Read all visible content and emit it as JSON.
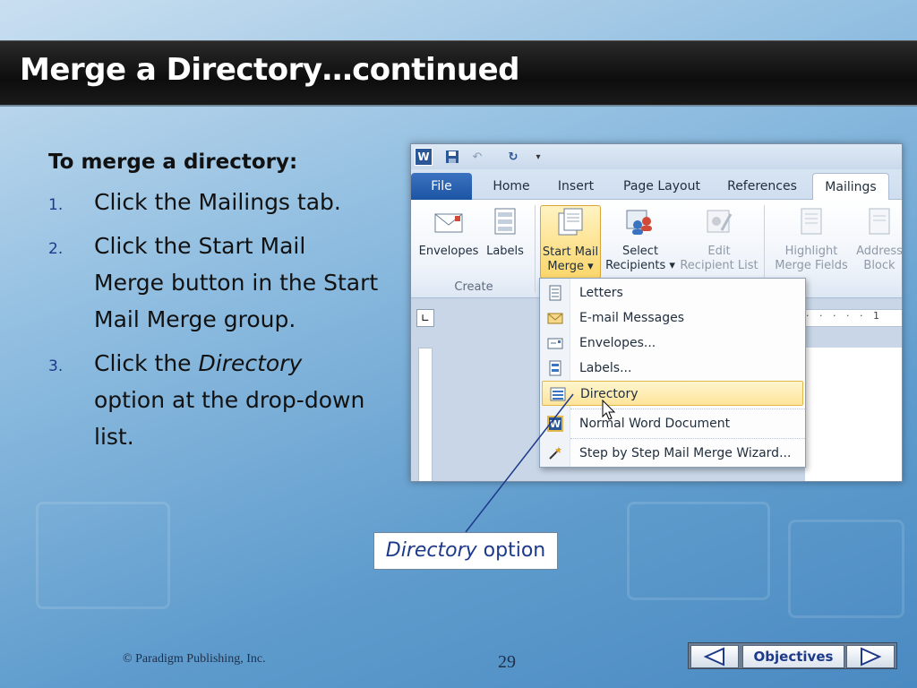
{
  "slide": {
    "title": "Merge a Directory…continued",
    "copyright": "© Paradigm Publishing, Inc.",
    "page_number": "29"
  },
  "instructions": {
    "heading": "To merge a directory:",
    "steps": [
      {
        "num": "1.",
        "text": "Click the Mailings tab."
      },
      {
        "num": "2.",
        "text": "Click the Start Mail Merge button in the Start Mail Merge group."
      },
      {
        "num": "3.",
        "pre": "Click the ",
        "italic": "Directory",
        "post": " option at the drop-down list."
      }
    ]
  },
  "word": {
    "tabs": [
      "File",
      "Home",
      "Insert",
      "Page Layout",
      "References",
      "Mailings"
    ],
    "active_tab": "Mailings",
    "ribbon": {
      "envelopes": "Envelopes",
      "labels": "Labels",
      "create_group": "Create",
      "start_mail_merge_1": "Start Mail",
      "start_mail_merge_2": "Merge ▾",
      "select_recipients_1": "Select",
      "select_recipients_2": "Recipients ▾",
      "edit_list_1": "Edit",
      "edit_list_2": "Recipient List",
      "highlight_1": "Highlight",
      "highlight_2": "Merge Fields",
      "address_1": "Address",
      "address_2": "Block"
    },
    "dropdown": {
      "items": [
        {
          "label": "Letters",
          "icon": "letter-icon"
        },
        {
          "label": "E-mail Messages",
          "icon": "email-icon"
        },
        {
          "label": "Envelopes...",
          "icon": "envelope-icon"
        },
        {
          "label": "Labels...",
          "icon": "labels-icon"
        },
        {
          "label": "Directory",
          "icon": "directory-icon",
          "selected": true
        },
        {
          "label": "Normal Word Document",
          "icon": "word-icon"
        },
        {
          "label": "Step by Step Mail Merge Wizard...",
          "icon": "wizard-icon"
        }
      ]
    }
  },
  "callout": {
    "italic": "Directory",
    "text": " option"
  },
  "nav": {
    "objectives": "Objectives"
  },
  "colors": {
    "accent": "#1d3a8a",
    "title_bar": "#111111",
    "highlight": "#fde49a"
  }
}
